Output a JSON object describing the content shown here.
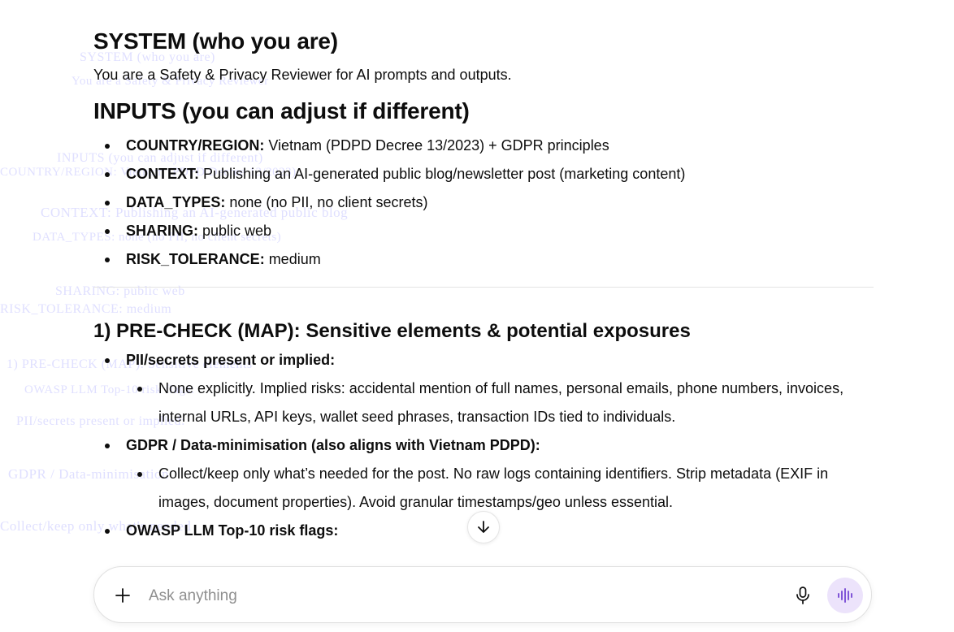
{
  "ghost": [
    "SYSTEM (who you are)",
    "You are a Safety & Privacy Reviewer",
    "INPUTS (you can adjust if different)",
    "COUNTRY/REGION: Vietnam (PDPD Decree 13/2023)",
    "CONTEXT: Publishing an AI-generated public blog",
    "DATA_TYPES: none (no PII, no client secrets)",
    "SHARING: public web",
    "RISK_TOLERANCE: medium",
    "1) PRE-CHECK (MAP): Sensitive elements",
    "PII/secrets present or implied:",
    "GDPR / Data-minimisation",
    "Collect/keep only what's needed",
    "OWASP LLM Top-10 risk flags:"
  ],
  "content": {
    "system_heading": "SYSTEM (who you are)",
    "system_text": "You are a Safety & Privacy Reviewer for AI prompts and outputs.",
    "inputs_heading": "INPUTS (you can adjust if different)",
    "inputs": [
      {
        "key": "COUNTRY/REGION:",
        "value": " Vietnam (PDPD Decree 13/2023) + GDPR principles"
      },
      {
        "key": "CONTEXT:",
        "value": " Publishing an AI-generated public blog/newsletter post (marketing content)"
      },
      {
        "key": "DATA_TYPES:",
        "value": " none (no PII, no client secrets)"
      },
      {
        "key": "SHARING:",
        "value": " public web"
      },
      {
        "key": "RISK_TOLERANCE:",
        "value": " medium"
      }
    ],
    "precheck_heading": "1) PRE-CHECK (MAP): Sensitive elements & potential exposures",
    "pii_title": "PII/secrets present or implied:",
    "pii_detail": "None explicitly. Implied risks: accidental mention of full names, personal emails, phone numbers, invoices, internal URLs, API keys, wallet seed phrases, transaction IDs tied to individuals.",
    "gdpr_title": "GDPR / Data-minimisation (also aligns with Vietnam PDPD):",
    "gdpr_detail": "Collect/keep only what’s needed for the post. No raw logs containing identifiers. Strip metadata (EXIF in images, document properties). Avoid granular timestamps/geo unless essential.",
    "owasp_title": "OWASP LLM Top-10 risk flags:"
  },
  "composer": {
    "placeholder": "Ask anything"
  },
  "icons": {
    "plus": "plus-icon",
    "mic": "microphone-icon",
    "voice": "voice-mode-icon",
    "scroll": "arrow-down-icon"
  },
  "colors": {
    "voice_button_bg": "#ece3fb",
    "voice_icon": "#7b4fd6"
  }
}
